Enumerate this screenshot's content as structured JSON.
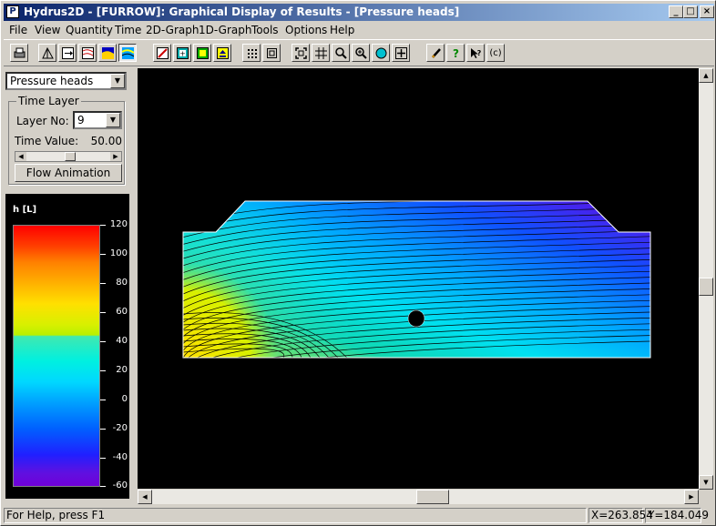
{
  "window": {
    "title": "Hydrus2D - [FURROW]: Graphical Display of Results - [Pressure heads]",
    "app_icon": "P"
  },
  "titlebar_buttons": {
    "minimize": "_",
    "maximize": "□",
    "close": "×"
  },
  "menu": [
    "File",
    "View",
    "Quantity",
    "Time",
    "2D-Graph",
    "1D-Graph",
    "Tools",
    "Options",
    "Help"
  ],
  "toolbar": {
    "icons": [
      "printer-icon",
      "display-mesh-icon",
      "arrow-icon",
      "contour-icon",
      "color-contour-icon",
      "color-spectrum-icon",
      "line-edit-icon",
      "add-node-icon",
      "insert-icon",
      "export-icon",
      "points-grid-icon",
      "check-box-icon",
      "zoom-extents-icon",
      "grid-icon",
      "zoom-icon",
      "zoom-in-icon",
      "sphere-icon",
      "move-icon",
      "pencil-icon",
      "help-icon",
      "whats-this-icon",
      "copyright-icon"
    ],
    "copyright_glyph": "(c)"
  },
  "side": {
    "quantity_select": "Pressure heads",
    "time_layer": {
      "title": "Time Layer",
      "layer_label": "Layer No:",
      "layer_value": "9",
      "time_label": "Time Value:",
      "time_value": "50.00",
      "slider_fraction": 0.5
    },
    "flow_button": "Flow Animation",
    "legend": {
      "title": "h  [L]",
      "ticks": [
        "120",
        "100",
        "80",
        "60",
        "40",
        "20",
        "0",
        "-20",
        "-40",
        "-60"
      ],
      "colors": {
        "top": "#ff0000",
        "mid": "#ffff00",
        "cyan": "#00ffff",
        "bottom": "#7000d8"
      }
    }
  },
  "statusbar": {
    "help": "For Help, press F1",
    "x": "X=263.854",
    "y": "Y=184.049"
  }
}
